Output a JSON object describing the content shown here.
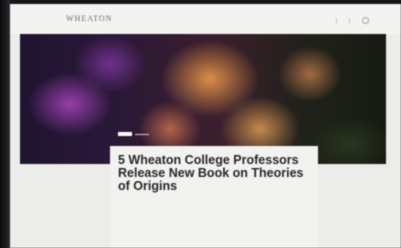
{
  "site": {
    "logo": "Wheaton"
  },
  "nav": {
    "items": [
      "",
      ""
    ]
  },
  "article": {
    "title": "5 Wheaton College Professors Release New Book on Theories of Origins",
    "byline": ""
  },
  "colors": {
    "page": "#ececeb",
    "headline": "#262626",
    "bezel": "#15161a"
  }
}
